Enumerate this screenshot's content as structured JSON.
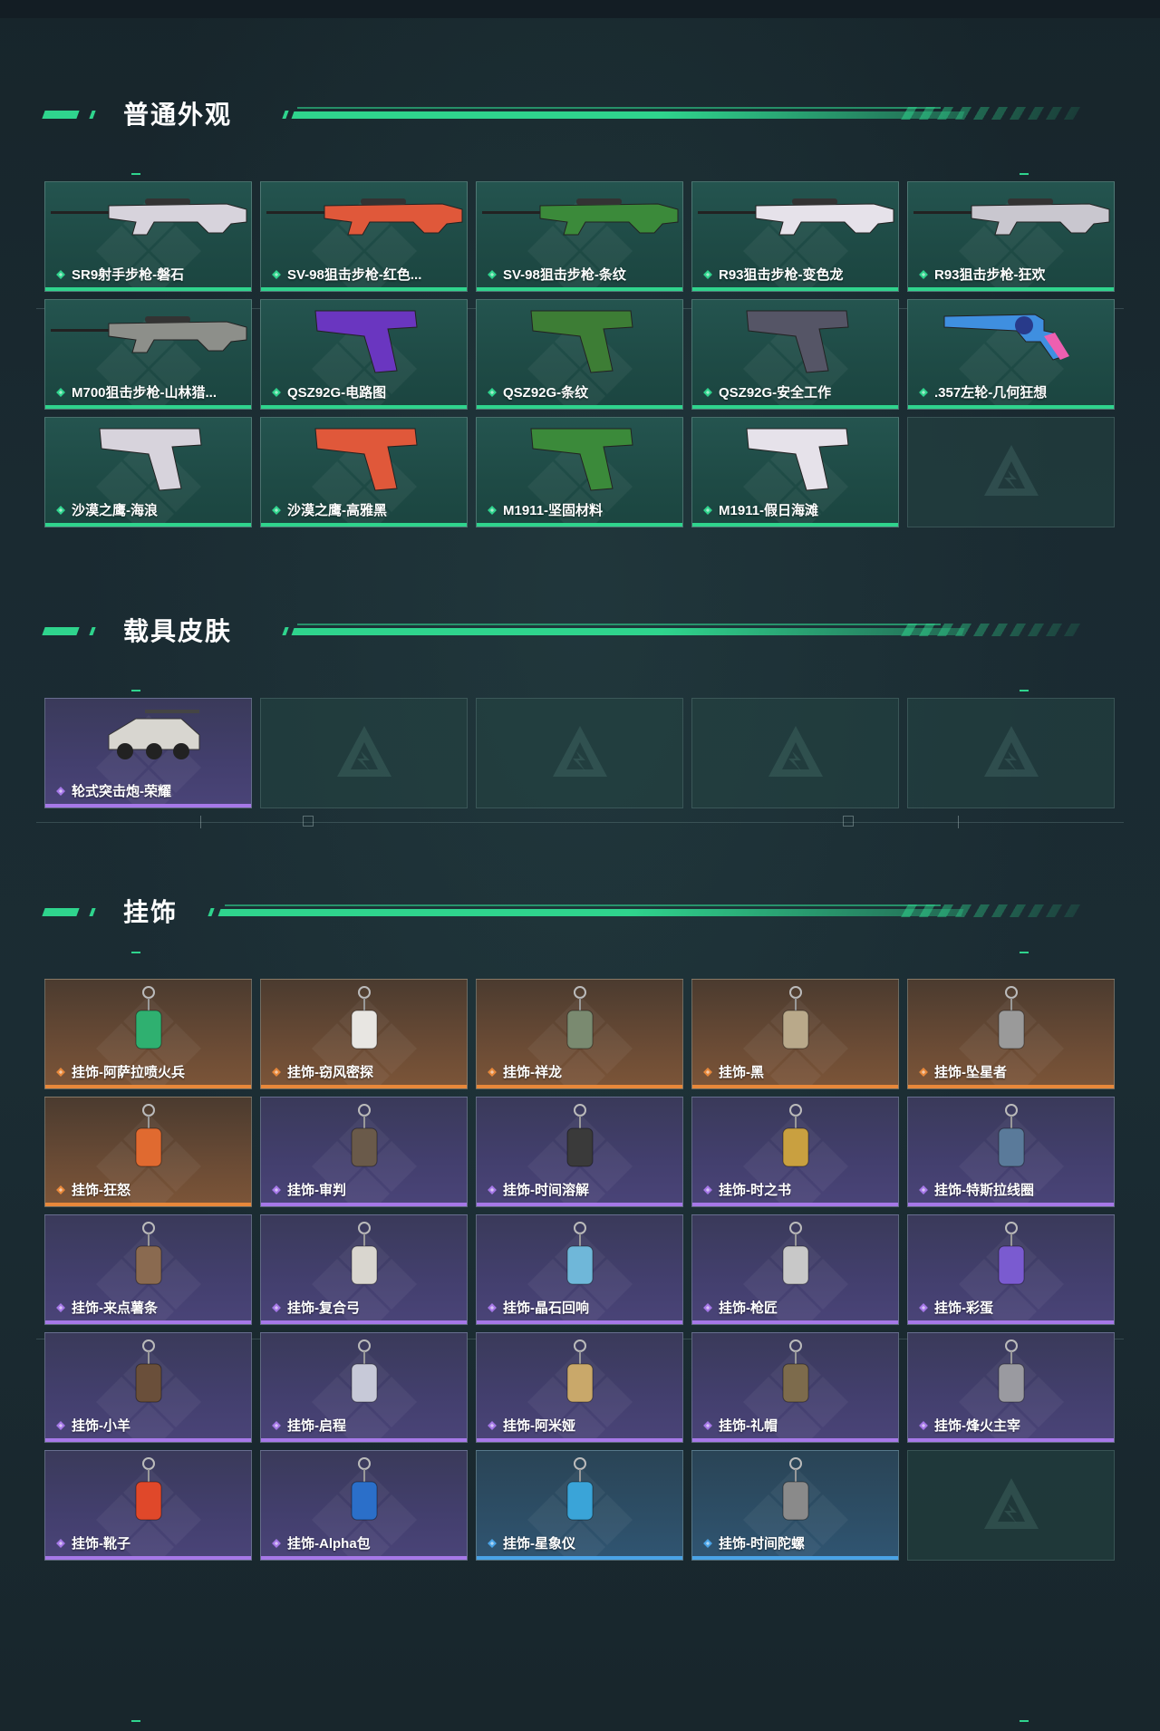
{
  "sections": [
    {
      "title": "普通外观",
      "items": [
        {
          "name": "SR9射手步枪-磐石",
          "rarity": "green",
          "icon": "rifle-icon"
        },
        {
          "name": "SV-98狙击步枪-红色...",
          "rarity": "green",
          "icon": "sniper-rifle-icon"
        },
        {
          "name": "SV-98狙击步枪-条纹",
          "rarity": "green",
          "icon": "sniper-rifle-icon"
        },
        {
          "name": "R93狙击步枪-变色龙",
          "rarity": "green",
          "icon": "sniper-rifle-icon"
        },
        {
          "name": "R93狙击步枪-狂欢",
          "rarity": "green",
          "icon": "sniper-rifle-icon"
        },
        {
          "name": "M700狙击步枪-山林猎...",
          "rarity": "green",
          "icon": "sniper-rifle-icon"
        },
        {
          "name": "QSZ92G-电路图",
          "rarity": "green",
          "icon": "pistol-icon"
        },
        {
          "name": "QSZ92G-条纹",
          "rarity": "green",
          "icon": "pistol-icon"
        },
        {
          "name": "QSZ92G-安全工作",
          "rarity": "green",
          "icon": "pistol-icon"
        },
        {
          "name": ".357左轮-几何狂想",
          "rarity": "green",
          "icon": "revolver-icon"
        },
        {
          "name": "沙漠之鹰-海浪",
          "rarity": "green",
          "icon": "pistol-icon"
        },
        {
          "name": "沙漠之鹰-高雅黑",
          "rarity": "green",
          "icon": "pistol-icon"
        },
        {
          "name": "M1911-坚固材料",
          "rarity": "green",
          "icon": "pistol-icon"
        },
        {
          "name": "M1911-假日海滩",
          "rarity": "green",
          "icon": "pistol-icon"
        },
        {
          "name": "",
          "rarity": "empty",
          "icon": "delta-logo-icon"
        }
      ]
    },
    {
      "title": "载具皮肤",
      "items": [
        {
          "name": "轮式突击炮-荣耀",
          "rarity": "purple",
          "icon": "vehicle-icon"
        },
        {
          "name": "",
          "rarity": "empty",
          "icon": "delta-logo-icon"
        },
        {
          "name": "",
          "rarity": "empty",
          "icon": "delta-logo-icon"
        },
        {
          "name": "",
          "rarity": "empty",
          "icon": "delta-logo-icon"
        },
        {
          "name": "",
          "rarity": "empty",
          "icon": "delta-logo-icon"
        }
      ]
    },
    {
      "title": "挂饰",
      "items": [
        {
          "name": "挂饰-阿萨拉喷火兵",
          "rarity": "orange",
          "icon": "charm-icon"
        },
        {
          "name": "挂饰-窃风密探",
          "rarity": "orange",
          "icon": "charm-icon"
        },
        {
          "name": "挂饰-祥龙",
          "rarity": "orange",
          "icon": "charm-icon"
        },
        {
          "name": "挂饰-黑",
          "rarity": "orange",
          "icon": "charm-icon"
        },
        {
          "name": "挂饰-坠星者",
          "rarity": "orange",
          "icon": "charm-icon"
        },
        {
          "name": "挂饰-狂怒",
          "rarity": "orange",
          "icon": "charm-icon"
        },
        {
          "name": "挂饰-审判",
          "rarity": "purple",
          "icon": "charm-icon"
        },
        {
          "name": "挂饰-时间溶解",
          "rarity": "purple",
          "icon": "charm-icon"
        },
        {
          "name": "挂饰-时之书",
          "rarity": "purple",
          "icon": "charm-icon"
        },
        {
          "name": "挂饰-特斯拉线圈",
          "rarity": "purple",
          "icon": "charm-icon"
        },
        {
          "name": "挂饰-来点薯条",
          "rarity": "purple",
          "icon": "charm-icon"
        },
        {
          "name": "挂饰-复合弓",
          "rarity": "purple",
          "icon": "charm-icon"
        },
        {
          "name": "挂饰-晶石回响",
          "rarity": "purple",
          "icon": "charm-icon"
        },
        {
          "name": "挂饰-枪匠",
          "rarity": "purple",
          "icon": "charm-icon"
        },
        {
          "name": "挂饰-彩蛋",
          "rarity": "purple",
          "icon": "charm-icon"
        },
        {
          "name": "挂饰-小羊",
          "rarity": "purple",
          "icon": "charm-icon"
        },
        {
          "name": "挂饰-启程",
          "rarity": "purple",
          "icon": "charm-icon"
        },
        {
          "name": "挂饰-阿米娅",
          "rarity": "purple",
          "icon": "charm-icon"
        },
        {
          "name": "挂饰-礼帽",
          "rarity": "purple",
          "icon": "charm-icon"
        },
        {
          "name": "挂饰-烽火主宰",
          "rarity": "purple",
          "icon": "charm-icon"
        },
        {
          "name": "挂饰-靴子",
          "rarity": "purple",
          "icon": "charm-icon"
        },
        {
          "name": "挂饰-Alpha包",
          "rarity": "purple",
          "icon": "charm-icon"
        },
        {
          "name": "挂饰-星象仪",
          "rarity": "blue",
          "icon": "charm-icon"
        },
        {
          "name": "挂饰-时间陀螺",
          "rarity": "blue",
          "icon": "charm-icon"
        },
        {
          "name": "",
          "rarity": "empty",
          "icon": "delta-logo-icon"
        }
      ]
    }
  ],
  "colors": {
    "accent": "#2fd48d",
    "green": "#2fd48d",
    "purple": "#a678e8",
    "orange": "#e8883a",
    "blue": "#4aa3e6",
    "background": "#1a2a31"
  }
}
